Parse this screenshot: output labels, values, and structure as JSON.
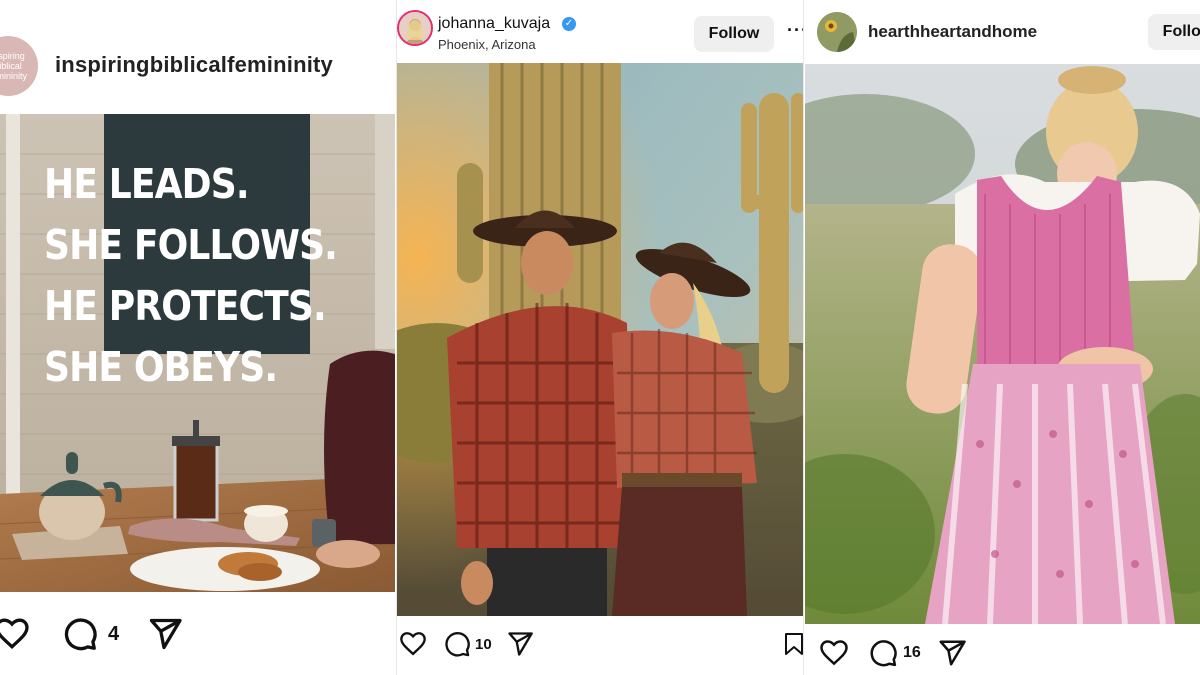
{
  "posts": [
    {
      "username": "inspiringbiblicalfemininity",
      "avatar_text": "inspiring biblical femininity",
      "image_text_lines": [
        "HE LEADS.",
        "SHE FOLLOWS.",
        "HE PROTECTS.",
        "SHE OBEYS."
      ],
      "comment_count": "4",
      "icons": [
        "heart-icon",
        "comment-icon",
        "share-icon"
      ]
    },
    {
      "username": "johanna_kuvaja",
      "verified": true,
      "location": "Phoenix, Arizona",
      "follow_label": "Follow",
      "more_label": "···",
      "comment_count": "10",
      "icons": [
        "heart-icon",
        "comment-icon",
        "share-icon",
        "bookmark-icon"
      ]
    },
    {
      "username": "hearthheartandhome",
      "follow_label": "Follow",
      "comment_count": "16",
      "icons": [
        "heart-icon",
        "comment-icon",
        "share-icon"
      ]
    }
  ],
  "colors": {
    "verified_blue": "#3897f0",
    "follow_button_bg": "#efefef",
    "story_ring": "#e1306c"
  }
}
